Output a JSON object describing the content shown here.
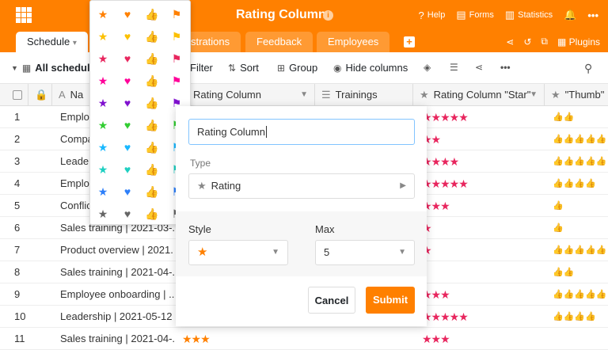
{
  "header": {
    "title": "Rating Column",
    "info_icon": "i",
    "actions": [
      {
        "icon": "help-icon",
        "glyph": "?",
        "label": "Help"
      },
      {
        "icon": "forms-icon",
        "glyph": "▤",
        "label": "Forms"
      },
      {
        "icon": "statistics-icon",
        "glyph": "▥",
        "label": "Statistics"
      }
    ]
  },
  "tabs": [
    {
      "label": "Schedule",
      "caret": "▾",
      "active": true
    },
    {
      "label": "strations"
    },
    {
      "label": "Feedback"
    },
    {
      "label": "Employees"
    }
  ],
  "tab_add": "+",
  "plugins_label": "Plugins",
  "toolbar": {
    "view_label": "All schedule",
    "filter": "Filter",
    "sort": "Sort",
    "group": "Group",
    "hide_columns": "Hide columns"
  },
  "columns": {
    "name": "Na",
    "rating": "Rating Column",
    "trainings": "Trainings",
    "star": "Rating Column \"Star\"",
    "thumb": "\"Thumb\""
  },
  "rows": [
    {
      "num": "1",
      "name": "Employ",
      "stars": "★★★★★",
      "thumbs": "👍👍"
    },
    {
      "num": "2",
      "name": "Compa",
      "stars": "★★",
      "thumbs": "👍👍👍👍👍"
    },
    {
      "num": "3",
      "name": "Leader",
      "stars": "★★★★",
      "thumbs": "👍👍👍👍👍"
    },
    {
      "num": "4",
      "name": "Employ",
      "stars": "★★★★★",
      "thumbs": "👍👍👍👍"
    },
    {
      "num": "5",
      "name": "Conflic",
      "stars": "★★★",
      "thumbs": "👍"
    },
    {
      "num": "6",
      "name": "Sales training | 2021-03-...",
      "stars": "★",
      "thumbs": "👍"
    },
    {
      "num": "7",
      "name": "Product overview | 2021...",
      "stars": "★",
      "thumbs": "👍👍👍👍👍"
    },
    {
      "num": "8",
      "name": "Sales training | 2021-04-...",
      "stars": "",
      "thumbs": "👍👍"
    },
    {
      "num": "9",
      "name": "Employee onboarding | ...",
      "stars": "★★★",
      "thumbs": "👍👍👍👍👍"
    },
    {
      "num": "10",
      "name": "Leadership | 2021-05-12",
      "stars": "★★★★★",
      "thumbs": "👍👍👍👍"
    },
    {
      "num": "11",
      "name": "Sales training | 2021-04-...",
      "stars": "★★★",
      "thumbs": ""
    }
  ],
  "row11_rating": "★★★",
  "picker": {
    "colors": [
      "#ff8000",
      "#fcc000",
      "#e8265e",
      "#ff0099",
      "#8011cf",
      "#32cd32",
      "#19b8ff",
      "#1ecfc1",
      "#2d7ff9",
      "#666666"
    ],
    "glyphs": [
      "★",
      "♥",
      "👍",
      "⚑"
    ]
  },
  "dialog": {
    "name_value": "Rating Column",
    "type_label": "Type",
    "type_value": "Rating",
    "type_icon": "★",
    "style_label": "Style",
    "style_value": "★",
    "max_label": "Max",
    "max_value": "5",
    "cancel": "Cancel",
    "submit": "Submit"
  }
}
